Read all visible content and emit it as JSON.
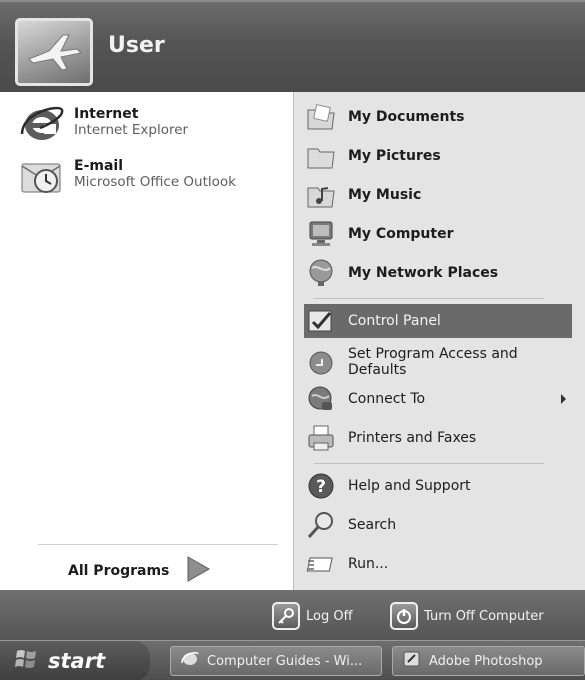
{
  "header": {
    "username": "User",
    "avatar_icon": "airplane-icon"
  },
  "pinned": [
    {
      "title": "Internet",
      "subtitle": "Internet Explorer",
      "icon": "internet-explorer-icon"
    },
    {
      "title": "E-mail",
      "subtitle": "Microsoft Office Outlook",
      "icon": "outlook-icon"
    }
  ],
  "all_programs": {
    "label": "All Programs",
    "icon": "green-arrow-icon"
  },
  "places": [
    {
      "label": "My Documents",
      "icon": "folder-documents-icon"
    },
    {
      "label": "My Pictures",
      "icon": "folder-pictures-icon"
    },
    {
      "label": "My Music",
      "icon": "folder-music-icon"
    },
    {
      "label": "My Computer",
      "icon": "computer-icon"
    },
    {
      "label": "My Network Places",
      "icon": "network-globe-icon"
    }
  ],
  "settings": [
    {
      "label": "Control Panel",
      "icon": "control-panel-icon",
      "highlighted": true
    },
    {
      "label": "Set Program Access and Defaults",
      "icon": "program-defaults-icon"
    },
    {
      "label": "Connect To",
      "icon": "connect-globe-icon",
      "has_submenu": true
    },
    {
      "label": "Printers and Faxes",
      "icon": "printer-icon"
    }
  ],
  "help": [
    {
      "label": "Help and Support",
      "icon": "help-icon"
    },
    {
      "label": "Search",
      "icon": "search-icon"
    },
    {
      "label": "Run...",
      "icon": "run-icon"
    }
  ],
  "footer": {
    "logoff_label": "Log Off",
    "turnoff_label": "Turn Off Computer"
  },
  "taskbar": {
    "start_label": "start",
    "tasks": [
      {
        "label": "Computer Guides - Wi...",
        "icon": "ie-task-icon"
      },
      {
        "label": "Adobe Photoshop",
        "icon": "photoshop-icon"
      }
    ]
  },
  "colors": {
    "highlight": "#6a6a6a",
    "right_pane": "#e4e4e4",
    "header": "#555555"
  }
}
